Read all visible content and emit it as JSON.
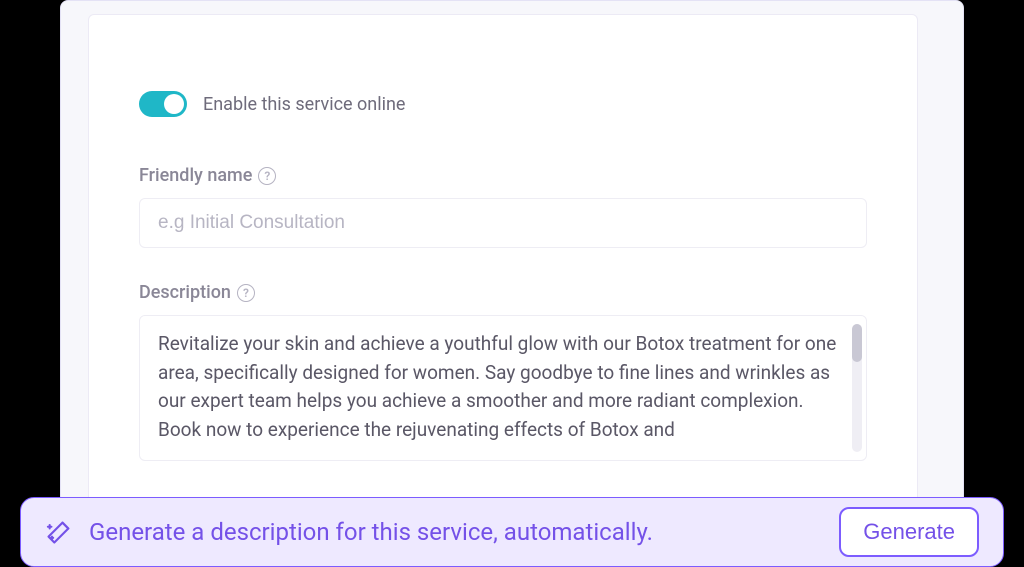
{
  "service": {
    "enable_toggle_label": "Enable this service online",
    "friendly_name": {
      "label": "Friendly name",
      "placeholder": "e.g Initial Consultation",
      "value": ""
    },
    "description": {
      "label": "Description",
      "value": "Revitalize your skin and achieve a youthful glow with our Botox treatment for one area, specifically designed for women. Say goodbye to fine lines and wrinkles as our expert team helps you achieve a smoother and more radiant complexion. Book now to experience the rejuvenating effects of Botox and"
    }
  },
  "ai_bar": {
    "prompt_text": "Generate a description for this service, automatically.",
    "generate_button": "Generate"
  }
}
